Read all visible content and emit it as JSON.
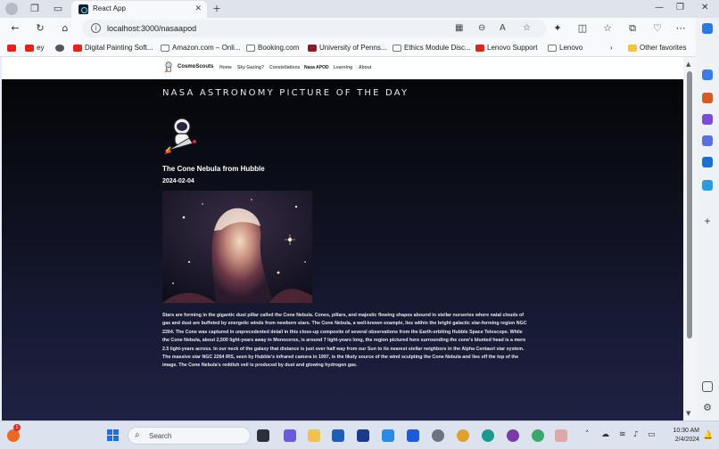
{
  "browser": {
    "tab_title": "React App",
    "url": "localhost:3000/nasaapod",
    "bookmarks": [
      "ey",
      "Digital Painting Soft...",
      "Amazon.com – Onli...",
      "Booking.com",
      "University of Penns...",
      "Ethics Module Disc...",
      "Lenovo Support",
      "Lenovo",
      "Other favorites"
    ]
  },
  "site": {
    "brand": "CosmoScouts",
    "nav": [
      "Home",
      "Sky Gazing?",
      "Constellations",
      "Nasa APOD",
      "Learning",
      "About"
    ],
    "active_nav": "Nasa APOD"
  },
  "apod": {
    "heading": "NASA ASTRONOMY PICTURE OF THE DAY",
    "title": "The Cone Nebula from Hubble",
    "date": "2024-02-04",
    "description": "Stars are forming in the gigantic dust pillar called the Cone Nebula. Cones, pillars, and majestic flowing shapes abound in stellar nurseries where natal clouds of gas and dust are buffeted by energetic winds from newborn stars. The Cone Nebula, a well-known example, lies within the bright galactic star-forming region NGC 2264. The Cone was captured in unprecedented detail in this close-up composite of several observations from the Earth-orbiting Hubble Space Telescope. While the Cone Nebula, about 2,500 light-years away in Monoceros, is around 7 light-years long, the region pictured here surrounding the cone's blunted head is a mere 2.5 light-years across. In our neck of the galaxy that distance is just over half way from our Sun to its nearest stellar neighbors in the Alpha Centauri star system. The massive star NGC 2264 IRS, seen by Hubble's infrared camera in 1997, is the likely source of the wind sculpting the Cone Nebula and lies off the top of the image. The Cone Nebula's reddish veil is produced by dust and glowing hydrogen gas."
  },
  "taskbar": {
    "search_placeholder": "Search",
    "time": "10:30 AM",
    "date": "2/4/2024",
    "weather_badge": "1"
  }
}
